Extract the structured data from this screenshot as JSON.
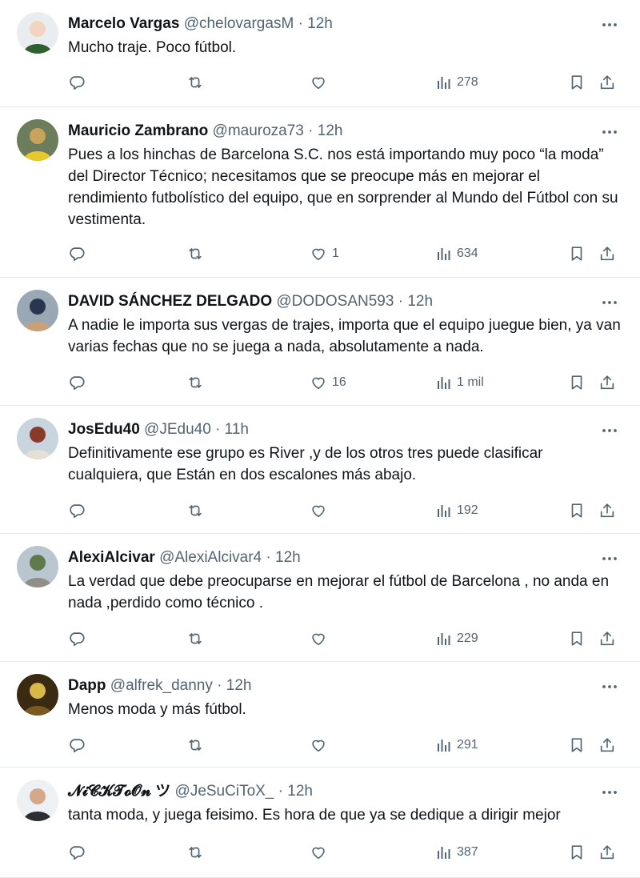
{
  "tweets": [
    {
      "name": "Marcelo Vargas",
      "handle": "@chelovargasM",
      "time": "12h",
      "text": "Mucho traje. Poco fútbol.",
      "replies": "",
      "retweets": "",
      "likes": "",
      "views": "278",
      "avatar_colors": [
        "#e9edf0",
        "#f2d4c0",
        "#2e5f2e"
      ]
    },
    {
      "name": "Mauricio Zambrano",
      "handle": "@mauroza73",
      "time": "12h",
      "text": "Pues a los hinchas de Barcelona S.C. nos está importando muy poco “la moda” del Director Técnico; necesitamos que se preocupe más en mejorar el rendimiento futbolístico del equipo, que en sorprender al Mundo del Fútbol con su vestimenta.",
      "replies": "",
      "retweets": "",
      "likes": "1",
      "views": "634",
      "avatar_colors": [
        "#6b7d5a",
        "#c9a35a",
        "#e8c82a"
      ]
    },
    {
      "name": "DAVID SÁNCHEZ DELGADO",
      "handle": "@DODOSAN593",
      "time": "12h",
      "text": "A nadie le importa sus vergas de trajes, importa que el equipo juegue bien, ya van varias fechas que no se juega a nada, absolutamente a nada.",
      "replies": "",
      "retweets": "",
      "likes": "16",
      "views": "1 mil",
      "avatar_colors": [
        "#9aa8b5",
        "#2a3550",
        "#c9a07a"
      ]
    },
    {
      "name": "JosEdu40",
      "handle": "@JEdu40",
      "time": "11h",
      "text": "Definitivamente ese grupo es River ,y de los otros tres puede clasificar cualquiera,  que Están en dos escalones más abajo.",
      "replies": "",
      "retweets": "",
      "likes": "",
      "views": "192",
      "avatar_colors": [
        "#c8d4de",
        "#8a3a2a",
        "#e5e0d5"
      ]
    },
    {
      "name": "AlexiAlcivar",
      "handle": "@AlexiAlcivar4",
      "time": "12h",
      "text": "La verdad que debe preocuparse en mejorar el fútbol de Barcelona , no anda en nada ,perdido como técnico .",
      "replies": "",
      "retweets": "",
      "likes": "",
      "views": "229",
      "avatar_colors": [
        "#b9c6cf",
        "#5f7a4a",
        "#8f8f88"
      ]
    },
    {
      "name": "Dapp",
      "handle": "@alfrek_danny",
      "time": "12h",
      "text": "Menos moda y más fútbol.",
      "replies": "",
      "retweets": "",
      "likes": "",
      "views": "291",
      "avatar_colors": [
        "#3a2a12",
        "#d9b84a",
        "#7a5a20"
      ]
    },
    {
      "name": "𝓝𝓲𝓒𝓚𝓣𝓸𝓞𝓷 ツ",
      "handle": "@JeSuCiToX_",
      "time": "12h",
      "text": "tanta moda, y juega feisimo. Es hora de que ya se dedique a dirigir mejor",
      "replies": "",
      "retweets": "",
      "likes": "",
      "views": "387",
      "avatar_colors": [
        "#eef1f3",
        "#d4a98a",
        "#2b2f33"
      ]
    }
  ],
  "icons": {
    "reply": "reply-icon",
    "retweet": "retweet-icon",
    "like": "heart-icon",
    "views": "views-icon",
    "bookmark": "bookmark-icon",
    "share": "share-icon",
    "more": "more-icon"
  },
  "colors": {
    "text": "#0f1419",
    "muted": "#536471",
    "divider": "#e6e9ea"
  }
}
